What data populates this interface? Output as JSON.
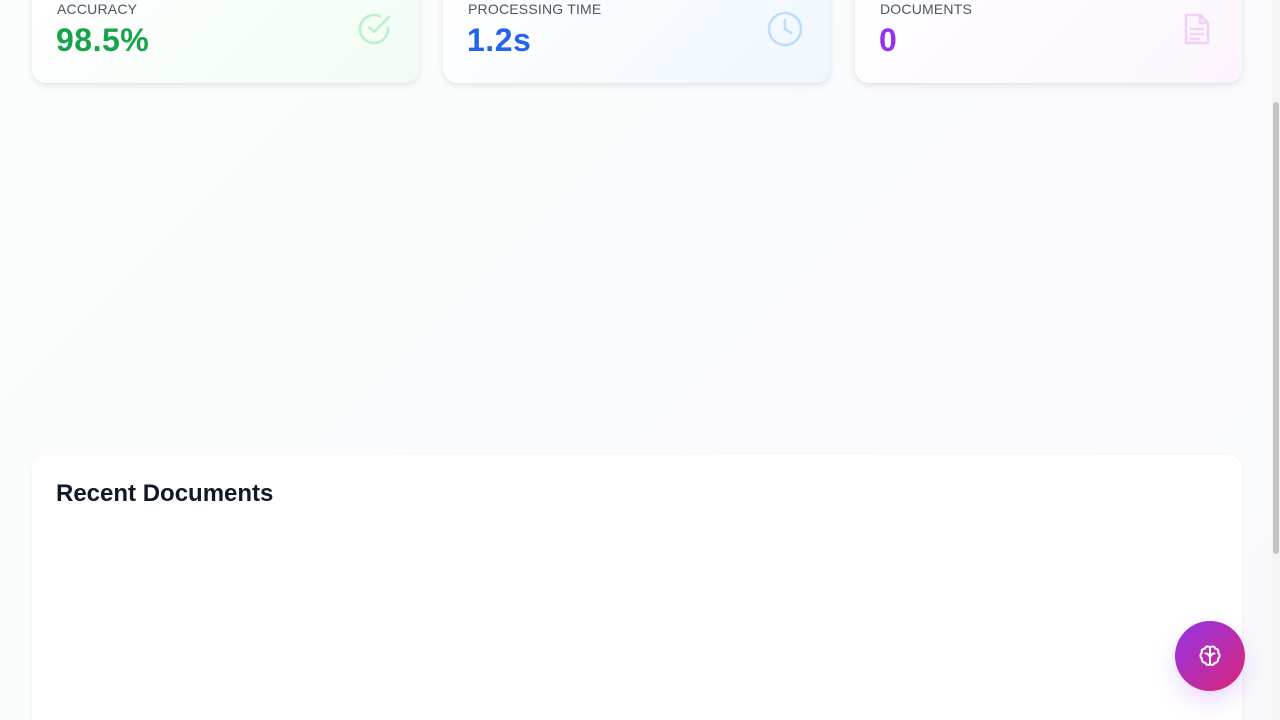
{
  "stats": [
    {
      "label": "ACCURACY",
      "value": "98.5%",
      "icon": "check-circle-icon",
      "color": "#16a34a"
    },
    {
      "label": "PROCESSING TIME",
      "value": "1.2s",
      "icon": "clock-icon",
      "color": "#2563eb"
    },
    {
      "label": "DOCUMENTS",
      "value": "0",
      "icon": "document-icon",
      "color": "#9333ea"
    }
  ],
  "recent": {
    "title": "Recent Documents"
  },
  "fab": {
    "icon": "brain-icon",
    "gradient": [
      "#9333ea",
      "#db2777"
    ]
  }
}
